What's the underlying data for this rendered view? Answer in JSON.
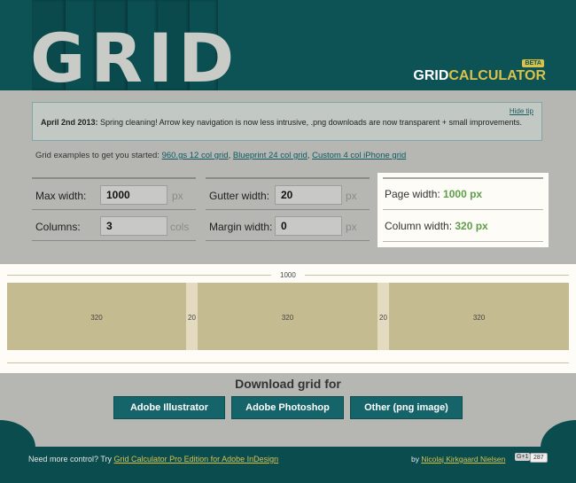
{
  "header": {
    "logo_text": "GRID",
    "brand_white": "GRID",
    "brand_yellow": "CALCULATOR",
    "beta": "BETA"
  },
  "tip": {
    "date": "April 2nd 2013:",
    "text": " Spring cleaning! Arrow key navigation is now less intrusive, .png downloads are now transparent + small improvements.",
    "hide_label": "Hide tip"
  },
  "examples": {
    "prefix": "Grid examples to get you started: ",
    "links": [
      "960.gs 12 col grid",
      "Blueprint 24 col grid",
      "Custom 4 col iPhone grid"
    ],
    "sep": ", "
  },
  "form": {
    "max_width": {
      "label": "Max width:",
      "value": "1000",
      "unit": "px"
    },
    "columns": {
      "label": "Columns:",
      "value": "3",
      "unit": "cols"
    },
    "gutter_width": {
      "label": "Gutter width:",
      "value": "20",
      "unit": "px"
    },
    "margin_width": {
      "label": "Margin width:",
      "value": "0",
      "unit": "px"
    }
  },
  "results": {
    "page_width_label": "Page width: ",
    "page_width_value": "1000 px",
    "column_width_label": "Column width: ",
    "column_width_value": "320 px"
  },
  "preview": {
    "total_label": "1000",
    "columns": [
      {
        "label": "320"
      },
      {
        "label": "320"
      },
      {
        "label": "320"
      }
    ],
    "gutters": [
      {
        "label": "20"
      },
      {
        "label": "20"
      }
    ]
  },
  "download": {
    "title": "Download grid for",
    "buttons": [
      "Adobe Illustrator",
      "Adobe Photoshop",
      "Other (png image)"
    ]
  },
  "footer": {
    "left_text": "Need more control? Try ",
    "left_link": "Grid Calculator Pro Edition for Adobe InDesign",
    "right_text": "by ",
    "right_link": "Nicolaj Kirkgaard Nielsen",
    "gplus_label": "G+1",
    "gplus_count": "287"
  },
  "colors": {
    "header_bg": "#0d5356",
    "accent_yellow": "#d8c24a",
    "column_fill": "#c5bb90",
    "result_green": "#5e9e4a"
  }
}
